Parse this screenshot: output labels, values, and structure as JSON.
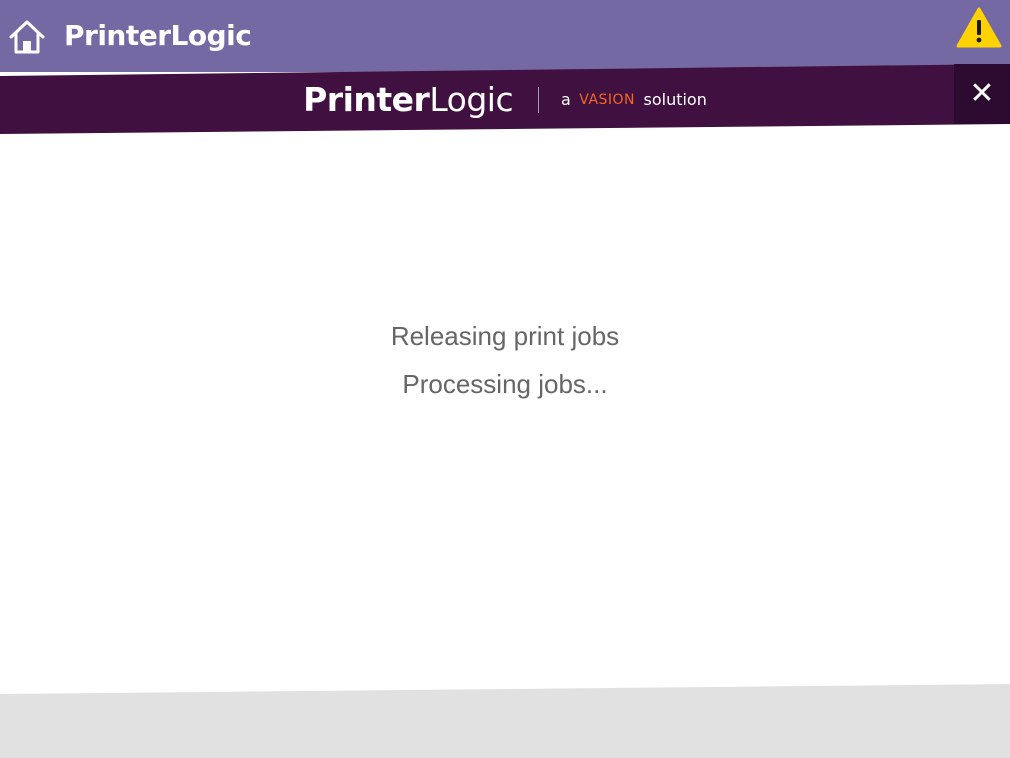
{
  "header": {
    "title": "PrinterLogic",
    "home_icon": "home-icon",
    "warning_icon": "warning-icon",
    "colors": {
      "topbar": "#7569a3",
      "warning": "#ffd200"
    }
  },
  "banner": {
    "brand_bold": "Printer",
    "brand_light": "Logic",
    "tag_prefix": "a",
    "tag_vasion": "VASION",
    "tag_suffix": "solution",
    "close_label": "✕",
    "colors": {
      "background": "#3f1040",
      "close_background": "#2d0a2f",
      "vasion": "#f26722"
    }
  },
  "status": {
    "primary": "Releasing print jobs",
    "secondary": "Processing jobs..."
  },
  "footer": {
    "color": "#e1e1e1"
  }
}
